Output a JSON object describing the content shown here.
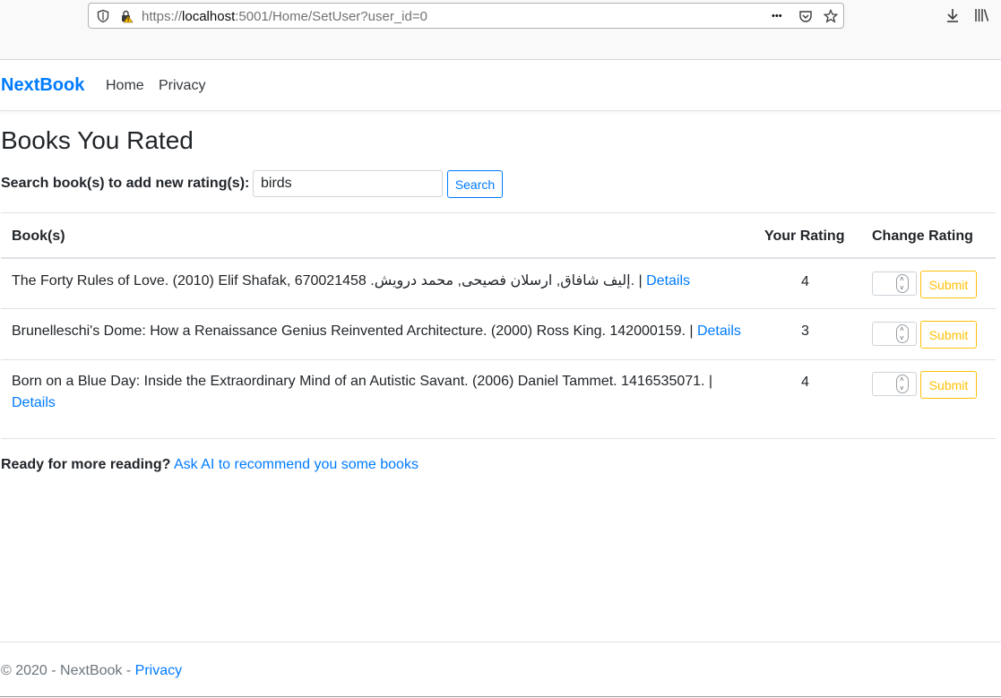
{
  "browser": {
    "url_prefix": "https://",
    "url_host": "localhost",
    "url_rest": ":5001/Home/SetUser?user_id=0",
    "url_more_glyph": "•••"
  },
  "navbar": {
    "brand": "NextBook",
    "links": [
      "Home",
      "Privacy"
    ]
  },
  "main": {
    "title": "Books You Rated",
    "search_label": "Search book(s) to add new rating(s):",
    "search_value": "birds",
    "search_button": "Search"
  },
  "table": {
    "headers": [
      "Book(s)",
      "Your Rating",
      "Change Rating"
    ],
    "rows": [
      {
        "text": "The Forty Rules of Love. (2010) Elif Shafak, 670021458 .إليف شافاق, ارسلان فصيحى, محمد درويش. |",
        "link": "Details",
        "rating": "4",
        "submit": "Submit"
      },
      {
        "text": "Brunelleschi's Dome: How a Renaissance Genius Reinvented Architecture. (2000) Ross King. 142000159. |",
        "link": "Details",
        "rating": "3",
        "submit": "Submit"
      },
      {
        "text": "Born on a Blue Day: Inside the Extraordinary Mind of an Autistic Savant. (2006) Daniel Tammet. 1416535071. |",
        "link": "Details",
        "rating": "4",
        "submit": "Submit"
      }
    ]
  },
  "more": {
    "prompt": "Ready for more reading?",
    "link": "Ask AI to recommend you some books"
  },
  "footer": {
    "text": "© 2020 - NextBook -",
    "link": "Privacy"
  }
}
